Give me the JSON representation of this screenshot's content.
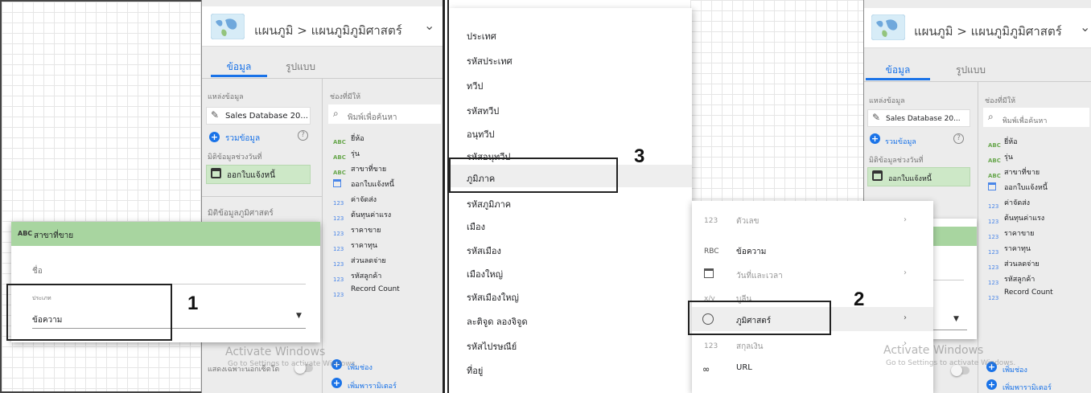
{
  "left": {
    "breadcrumb": "แผนภูมิ > แผนภูมิภูมิศาสตร์",
    "tabs": {
      "data": "ข้อมูล",
      "style": "รูปแบบ"
    },
    "data_source": {
      "heading": "แหล่งข้อมูล",
      "source_name": "Sales Database 20...",
      "blend_label": "รวมข้อมูล",
      "date_range_heading": "มิติข้อมูลช่วงวันที่",
      "date_range_value": "ออกใบแจ้งหนี้",
      "geo_dim_heading": "มิติข้อมูลภูมิศาสตร์"
    },
    "available": {
      "heading": "ช่องที่มีให้",
      "search_placeholder": "พิมพ์เพื่อค้นหา",
      "fields": [
        {
          "type": "ABC",
          "name": "ยี่ห้อ"
        },
        {
          "type": "ABC",
          "name": "รุ่น"
        },
        {
          "type": "ABC",
          "name": "สาขาที่ขาย"
        },
        {
          "type": "cal",
          "name": "ออกใบแจ้งหนี้"
        },
        {
          "type": "123",
          "name": "ค่าจัดส่ง"
        },
        {
          "type": "123",
          "name": "ต้นทุนค่าแรง"
        },
        {
          "type": "123",
          "name": "ราคาขาย"
        },
        {
          "type": "123",
          "name": "ราคาทุน"
        },
        {
          "type": "123",
          "name": "ส่วนลดจ่าย"
        },
        {
          "type": "123",
          "name": "รหัสลูกค้า"
        },
        {
          "type": "123",
          "name": "Record Count"
        }
      ],
      "add_field": "เพิ่มช่อง",
      "add_param": "เพิ่มพารามิเตอร์"
    },
    "popup": {
      "field_type_badge": "ABC",
      "field_title": "สาขาที่ขาย",
      "name_placeholder": "ชื่อ",
      "type_label": "ประเภท",
      "type_value": "ข้อความ"
    },
    "bottom": {
      "label": "แสดงเฉพาะนอกเซ็ตโต"
    },
    "callout": "1"
  },
  "right": {
    "breadcrumb": "แผนภูมิ > แผนภูมิภูมิศาสตร์",
    "tabs": {
      "data": "ข้อมูล",
      "style": "รูปแบบ"
    },
    "data_source": {
      "heading": "แหล่งข้อมูล",
      "source_name": "Sales Database 20...",
      "blend_label": "รวมข้อมูล",
      "date_range_heading": "มิติข้อมูลช่วงวันที่",
      "date_range_value": "ออกใบแจ้งหนี้"
    },
    "available": {
      "heading": "ช่องที่มีให้",
      "search_placeholder": "พิมพ์เพื่อค้นหา",
      "fields": [
        {
          "type": "ABC",
          "name": "ยี่ห้อ"
        },
        {
          "type": "ABC",
          "name": "รุ่น"
        },
        {
          "type": "ABC",
          "name": "สาขาที่ขาย"
        },
        {
          "type": "cal",
          "name": "ออกใบแจ้งหนี้"
        },
        {
          "type": "123",
          "name": "ค่าจัดส่ง"
        },
        {
          "type": "123",
          "name": "ต้นทุนค่าแรง"
        },
        {
          "type": "123",
          "name": "ราคาขาย"
        },
        {
          "type": "123",
          "name": "ราคาทุน"
        },
        {
          "type": "123",
          "name": "ส่วนลดจ่าย"
        },
        {
          "type": "123",
          "name": "รหัสลูกค้า"
        },
        {
          "type": "123",
          "name": "Record Count"
        }
      ],
      "add_field": "เพิ่มช่อง",
      "add_param": "เพิ่มพารามิเตอร์"
    },
    "geo_menu": [
      "ประเทศ",
      "รหัสประเทศ",
      "ทวีป",
      "รหัสทวีป",
      "อนุทวีป",
      "รหัสอนุทวีป",
      "ภูมิภาค",
      "รหัสภูมิภาค",
      "เมือง",
      "รหัสเมือง",
      "เมืองใหญ่",
      "รหัสเมืองใหญ่",
      "ละติจูด ลองจิจูด",
      "รหัสไปรษณีย์",
      "ที่อยู่"
    ],
    "type_menu": [
      {
        "icon": "123",
        "label": "ตัวเลข",
        "arrow": true,
        "dim": true
      },
      {
        "icon": "RBC",
        "label": "ข้อความ",
        "arrow": false,
        "dim": false
      },
      {
        "icon": "cal",
        "label": "วันที่และเวลา",
        "arrow": true,
        "dim": true
      },
      {
        "icon": "x/y",
        "label": "บูลีน",
        "arrow": false,
        "dim": true
      },
      {
        "icon": "globe",
        "label": "ภูมิศาสตร์",
        "arrow": true,
        "dim": false
      },
      {
        "icon": "123",
        "label": "สกุลเงิน",
        "arrow": true,
        "dim": true
      },
      {
        "icon": "link",
        "label": "URL",
        "arrow": false,
        "dim": false
      }
    ],
    "callout_2": "2",
    "callout_3": "3"
  },
  "watermark": {
    "title": "Activate Windows",
    "subtitle": "Go to Settings to activate Windows."
  },
  "colors": {
    "accent": "#1a73e8",
    "chip_green": "#cde8c7",
    "header_green": "#a8d5a0"
  }
}
